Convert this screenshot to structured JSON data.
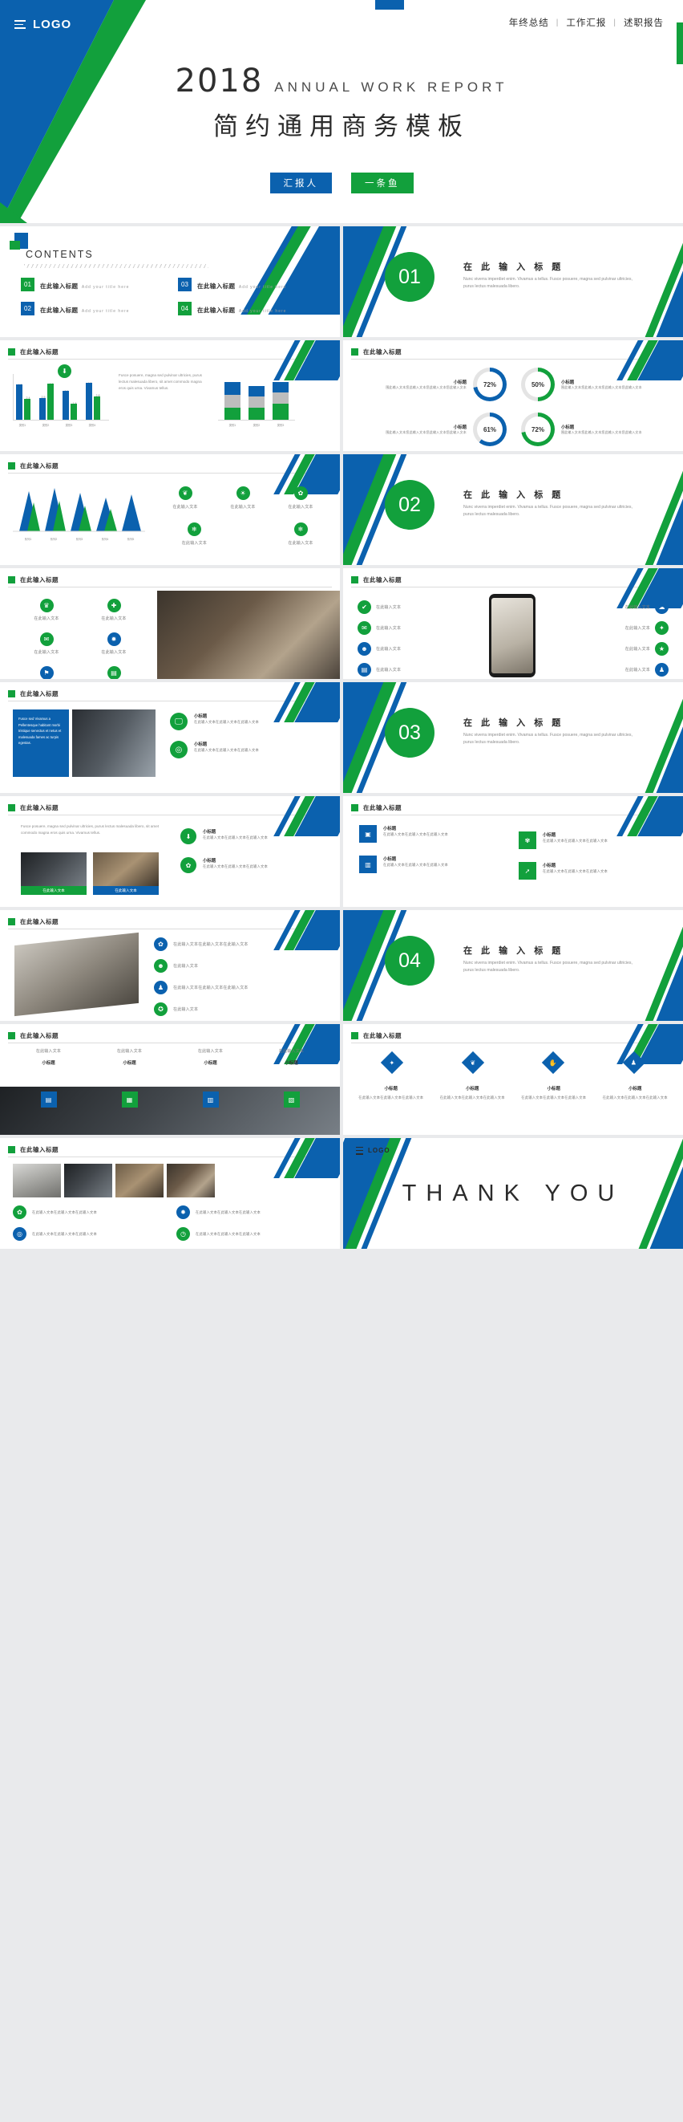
{
  "brand": {
    "blue": "#0B61AE",
    "green": "#12A03C",
    "dark": "#2b2b2b",
    "muted": "#8d8d8d"
  },
  "cover": {
    "logo": "LOGO",
    "nav": [
      "年终总结",
      "工作汇报",
      "述职报告"
    ],
    "separator": "|",
    "year": "2018",
    "subtitle": "ANNUAL WORK REPORT",
    "title": "简约通用商务模板",
    "badge_role": "汇报人",
    "badge_name": "一条鱼"
  },
  "contents": {
    "title": "CONTENTS",
    "items": [
      {
        "num": "01",
        "color": "green",
        "cn": "在此输入标题",
        "en": "Add your title here"
      },
      {
        "num": "03",
        "color": "blue",
        "cn": "在此输入标题",
        "en": "Add your title here"
      },
      {
        "num": "02",
        "color": "blue",
        "cn": "在此输入标题",
        "en": "Add your title here"
      },
      {
        "num": "04",
        "color": "green",
        "cn": "在此输入标题",
        "en": "Add your title here"
      }
    ]
  },
  "sections": [
    {
      "num": "01",
      "title": "在 此 输 入 标 题",
      "desc": "Nunc viverra imperdiet enim. Vivamus a tellus. Fusce posuere, magna sed pulvinar ultricies, purus lectus malesuada libero."
    },
    {
      "num": "02",
      "title": "在 此 输 入 标 题",
      "desc": "Nunc viverra imperdiet enim. Vivamus a tellus. Fusce posuere, magna sed pulvinar ultricies, purus lectus malesuada libero."
    },
    {
      "num": "03",
      "title": "在 此 输 入 标 题",
      "desc": "Nunc viverra imperdiet enim. Vivamus a tellus. Fusce posuere, magna sed pulvinar ultricies, purus lectus malesuada libero."
    },
    {
      "num": "04",
      "title": "在 此 输 入 标 题",
      "desc": "Nunc viverra imperdiet enim. Vivamus a tellus. Fusce posuere, magna sed pulvinar ultricies, purus lectus malesuada libero."
    }
  ],
  "slide_header": "在此输入标题",
  "chart_data": [
    {
      "type": "bar",
      "title": "在此输入标题",
      "categories": [
        "类别1",
        "类别2",
        "类别3",
        "类别4"
      ],
      "series": [
        {
          "name": "系列1",
          "color": "#0B61AE",
          "values": [
            4.3,
            2.5,
            3.5,
            4.5
          ]
        },
        {
          "name": "系列2",
          "color": "#12A03C",
          "values": [
            2.4,
            4.4,
            1.8,
            2.8
          ]
        }
      ],
      "value_labels": [
        "4.3",
        "2.4",
        "2.5",
        "4.4",
        "3.5",
        "1.8",
        "4.5",
        "2.8"
      ],
      "ylim": [
        0,
        5
      ],
      "grid": false,
      "legend": "none",
      "note": "clustered column chart, left half of slide"
    },
    {
      "type": "bar",
      "subtype": "stacked",
      "title": "在此输入标题",
      "categories": [
        "类别1",
        "类别2",
        "类别3"
      ],
      "series": [
        {
          "name": "系列1",
          "color": "#0B61AE",
          "values": [
            2.0,
            2.0,
            3.0
          ]
        },
        {
          "name": "系列2",
          "color": "#bdbdbd",
          "values": [
            4.4,
            1.8,
            2.8
          ]
        },
        {
          "name": "系列3",
          "color": "#12A03C",
          "values": [
            2.0,
            2.0,
            3.0
          ]
        }
      ],
      "ylim": [
        0,
        9
      ],
      "grid": false,
      "legend": "none",
      "note": "stacked column chart, right half of same slide"
    },
    {
      "type": "area",
      "title": "在此输入标题",
      "categories": [
        "系列1",
        "系列2",
        "系列3",
        "系列4",
        "系列5"
      ],
      "series": [
        {
          "name": "蓝色",
          "color": "#0B61AE",
          "values": [
            60,
            72,
            80,
            66,
            74
          ]
        },
        {
          "name": "绿色",
          "color": "#12A03C",
          "values": [
            48,
            58,
            64,
            52,
            60
          ]
        }
      ],
      "ylim": [
        0,
        100
      ],
      "grid": false,
      "legend": "none",
      "note": "spiky triangular area/peak chart"
    },
    {
      "type": "pie",
      "subtype": "donut-gauge",
      "title": "在此输入标题",
      "items": [
        {
          "label": "小标题",
          "value": 72,
          "display": "72%",
          "color": "#0B61AE",
          "desc": "围此输入文本您此输入文本您此输入文本您此输入文本"
        },
        {
          "label": "小标题",
          "value": 50,
          "display": "50%",
          "color": "#12A03C",
          "desc": "围此输入文本您此输入文本您此输入文本您此输入文本"
        },
        {
          "label": "小标题",
          "value": 61,
          "display": "61%",
          "color": "#0B61AE",
          "desc": "围此输入文本您此输入文本您此输入文本您此输入文本"
        },
        {
          "label": "小标题",
          "value": 72,
          "display": "72%",
          "color": "#12A03C",
          "desc": "围此输入文本您此输入文本您此输入文本您此输入文本"
        }
      ]
    }
  ],
  "placeholders": {
    "cn_text": "在此输入文本",
    "cn_long": "在此输入文本在此输入文本在此输入文本",
    "cn_sub": "小标题",
    "en_para": "Fusce posuere, magna sed pulvinar ultricies, purus lectus malesuada libero, sit amet commodo magna eros quis urna. Vivamus tellus.",
    "en_block": "Fusce sed Vivamus a Pellentesque habitant morbi tristique senectus et netus et malesuada fames ac turpis egestas."
  },
  "icon_slides": {
    "icons_row1": [
      "leaf-icon",
      "bulb-icon",
      "gear-icon"
    ],
    "icons_row2": [
      "snowflake-icon",
      "snowflake-icon"
    ],
    "icons_left": [
      "trophy-icon",
      "gift-icon",
      "chat-icon",
      "globe-icon",
      "lock-icon",
      "chart-icon"
    ],
    "icons_phone": [
      "check-icon",
      "mail-icon",
      "user-icon",
      "doc-icon",
      "cloud-icon",
      "pin-icon"
    ],
    "icons_cards": [
      "monitor-icon",
      "target-icon",
      "camera-icon",
      "bars-icon",
      "flower-icon",
      "rocket-icon"
    ],
    "icons_list": [
      "gear-icon",
      "people-icon",
      "person-icon",
      "cart-icon",
      "star-icon"
    ],
    "icons_building": [
      "chart-icon",
      "book-icon",
      "bars-icon",
      "signal-icon"
    ],
    "icons_diamond": [
      "pin-icon",
      "tree-icon",
      "hand-icon",
      "person-icon"
    ],
    "icons_bottom": [
      "gear-icon",
      "globe-icon",
      "target-icon",
      "clock-icon"
    ]
  },
  "thank_you": {
    "logo": "LOGO",
    "text": "THANK YOU"
  }
}
